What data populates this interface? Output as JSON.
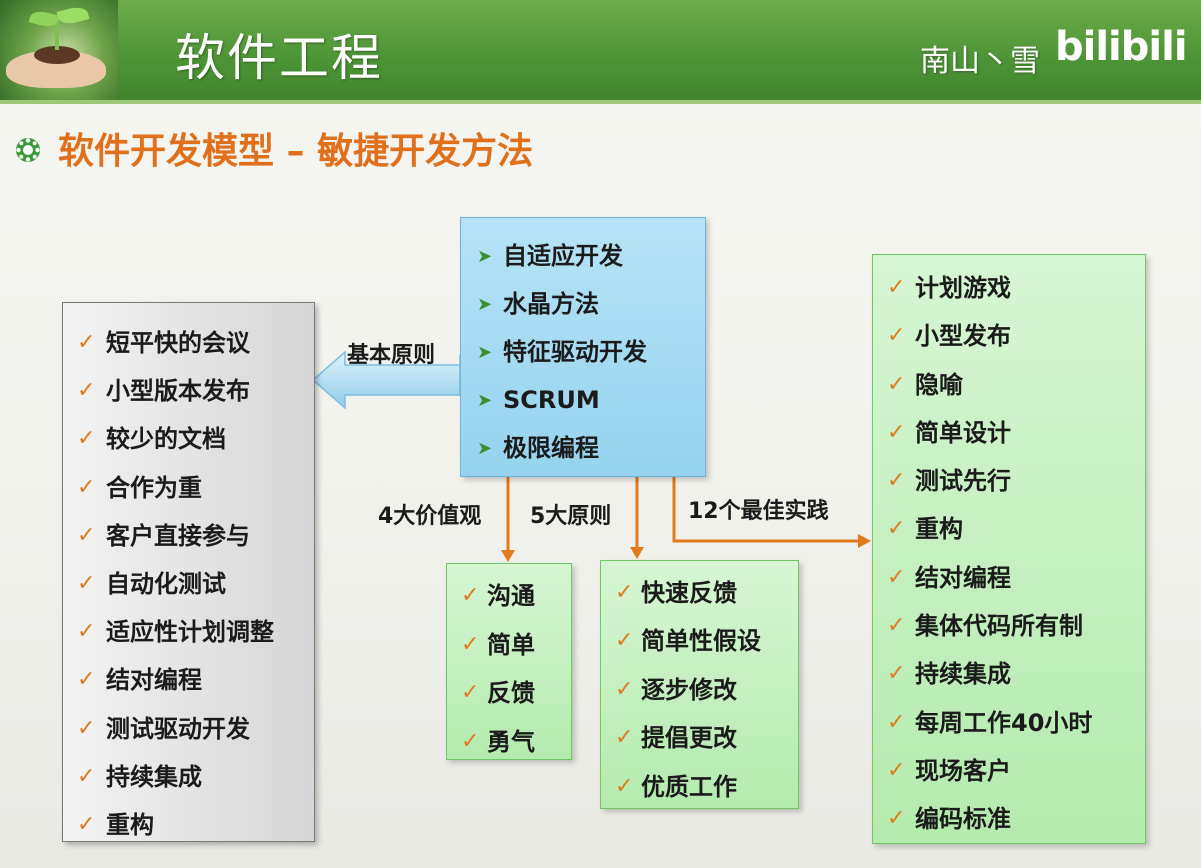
{
  "header": {
    "title": "软件工程",
    "watermark": "南山丶雪",
    "brand": "bilibili"
  },
  "slide": {
    "title": "软件开发模型 – 敏捷开发方法"
  },
  "methods": [
    "自适应开发",
    "水晶方法",
    "特征驱动开发",
    "SCRUM",
    "极限编程"
  ],
  "basic_principles": {
    "label": "基本原则",
    "items": [
      "短平快的会议",
      "小型版本发布",
      "较少的文档",
      "合作为重",
      "客户直接参与",
      "自动化测试",
      "适应性计划调整",
      "结对编程",
      "测试驱动开发",
      "持续集成",
      "重构"
    ]
  },
  "values": {
    "label": "4大价值观",
    "items": [
      "沟通",
      "简单",
      "反馈",
      "勇气"
    ]
  },
  "principles": {
    "label": "5大原则",
    "items": [
      "快速反馈",
      "简单性假设",
      "逐步修改",
      "提倡更改",
      "优质工作"
    ]
  },
  "practices": {
    "label": "12个最佳实践",
    "items": [
      "计划游戏",
      "小型发布",
      "隐喻",
      "简单设计",
      "测试先行",
      "重构",
      "结对编程",
      "集体代码所有制",
      "持续集成",
      "每周工作40小时",
      "现场客户",
      "编码标准"
    ]
  },
  "colors": {
    "header_green": "#4f9638",
    "title_orange": "#e0701c",
    "arrow_orange": "#e07b1e",
    "blue_box": "#a6dcf2",
    "green_box": "#c4f0bf",
    "gray_box": "#e0e0e0"
  }
}
